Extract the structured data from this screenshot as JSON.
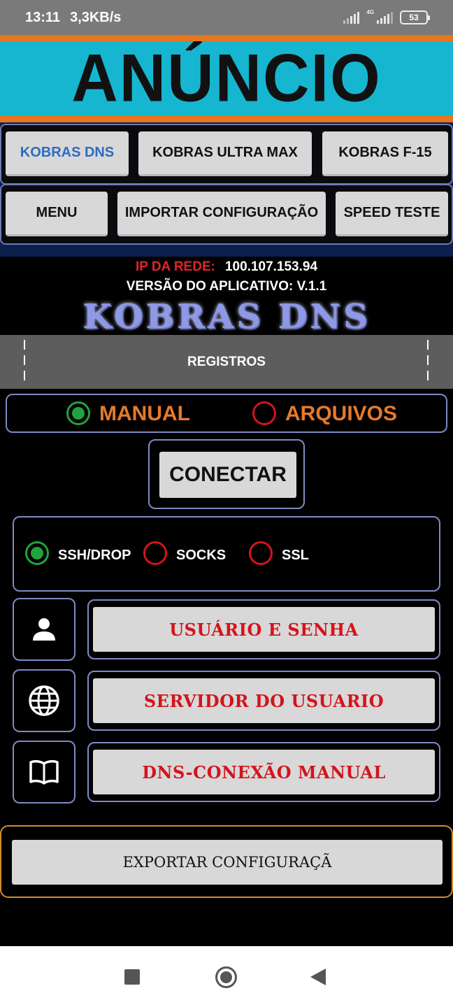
{
  "status_bar": {
    "time": "13:11",
    "speed": "3,3KB/s",
    "network": "4G",
    "battery": "53"
  },
  "banner": {
    "text": "ANÚNCIO"
  },
  "tabs_row1": [
    "KOBRAS DNS",
    "KOBRAS ULTRA MAX",
    "KOBRAS F-15"
  ],
  "tabs_row2": [
    "MENU",
    "IMPORTAR CONFIGURAÇÃO",
    "SPEED TESTE"
  ],
  "active_tab": "KOBRAS DNS",
  "info": {
    "ip_label": "IP DA REDE:",
    "ip_value": "100.107.153.94",
    "version": "VERSÃO DO APLICATIVO: V.1.1",
    "logo": "KOBRAS DNS"
  },
  "registros": {
    "label": "REGISTROS"
  },
  "mode": {
    "options": [
      "MANUAL",
      "ARQUIVOS"
    ],
    "selected": "MANUAL"
  },
  "connect_label": "CONECTAR",
  "protocol": {
    "options": [
      "SSH/DROP",
      "SOCKS",
      "SSL"
    ],
    "selected": "SSH/DROP"
  },
  "fields": [
    {
      "icon": "user-icon",
      "label": "USUÁRIO E SENHA"
    },
    {
      "icon": "globe-icon",
      "label": "SERVIDOR DO USUARIO"
    },
    {
      "icon": "book-icon",
      "label": "DNS-CONEXÃO MANUAL"
    }
  ],
  "export_label": "EXPORTAR CONFIGURAÇÃ",
  "colors": {
    "banner_bg": "#16b6d1",
    "accent_orange": "#e6761f",
    "radio_on": "#1ea43c",
    "radio_off": "#d3141c",
    "active_tab_text": "#2d6cc0",
    "border": "#7f8ac4"
  }
}
